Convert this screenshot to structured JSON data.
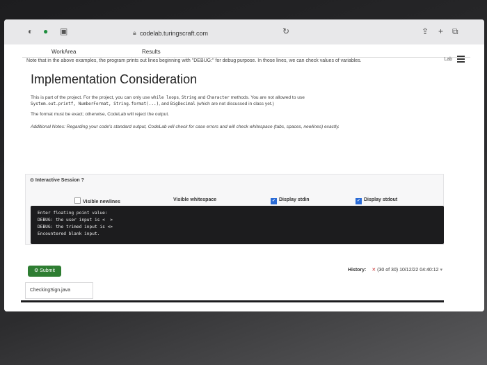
{
  "browser": {
    "url": "codelab.turingscraft.com"
  },
  "tabs": [
    "WorkArea",
    "Results"
  ],
  "header": {
    "note": "Note that in the above examples, the program prints out lines beginning with \"DEBUG:\" for debug purpose. In those lines, we can check values of variables.",
    "lab_link": "Lab"
  },
  "content": {
    "title": "Implementation Consideration",
    "p1_prefix": "This is part of the project. For the project, you can only use",
    "p1_code1": "while loops",
    "p1_mid1": ",",
    "p1_code2": "String",
    "p1_mid2": "and",
    "p1_code3": "Character",
    "p1_mid3": "methods. You are not allowed to use",
    "p1_line2_code": "System.out.printf, NumberFormat, String.format(...)",
    "p1_line2_mid": ", and",
    "p1_line2_code2": "BigDecimal",
    "p1_line2_suffix": "(which are not discussed in class yet.)",
    "p2": "The format must be exact; otherwise, CodeLab will reject the output.",
    "p3": "Additional Notes: Regarding your code's standard output, CodeLab will check for case errors and will check whitespace (tabs, spaces, newlines) exactly."
  },
  "session": {
    "label": "Interactive Session ?",
    "options": [
      {
        "label": "Visible newlines",
        "checked": false
      },
      {
        "label": "Visible whitespace",
        "checked": false
      },
      {
        "label": "Display stdin",
        "checked": true
      },
      {
        "label": "Display stdout",
        "checked": true
      }
    ],
    "terminal_text": "Enter floating point value:\nDEBUG: the user input is <  >\nDEBUG: the trimed input is <>\nEncountered blank input."
  },
  "actions": {
    "submit_label": "Submit",
    "history_label": "History:",
    "history_value": "(30 of 30) 10/12/22 04:40:12"
  },
  "file": {
    "name": "CheckingSign.java"
  },
  "colors": {
    "accent": "#2a6bd6",
    "submit": "#2e7d32",
    "error": "#c62828"
  }
}
